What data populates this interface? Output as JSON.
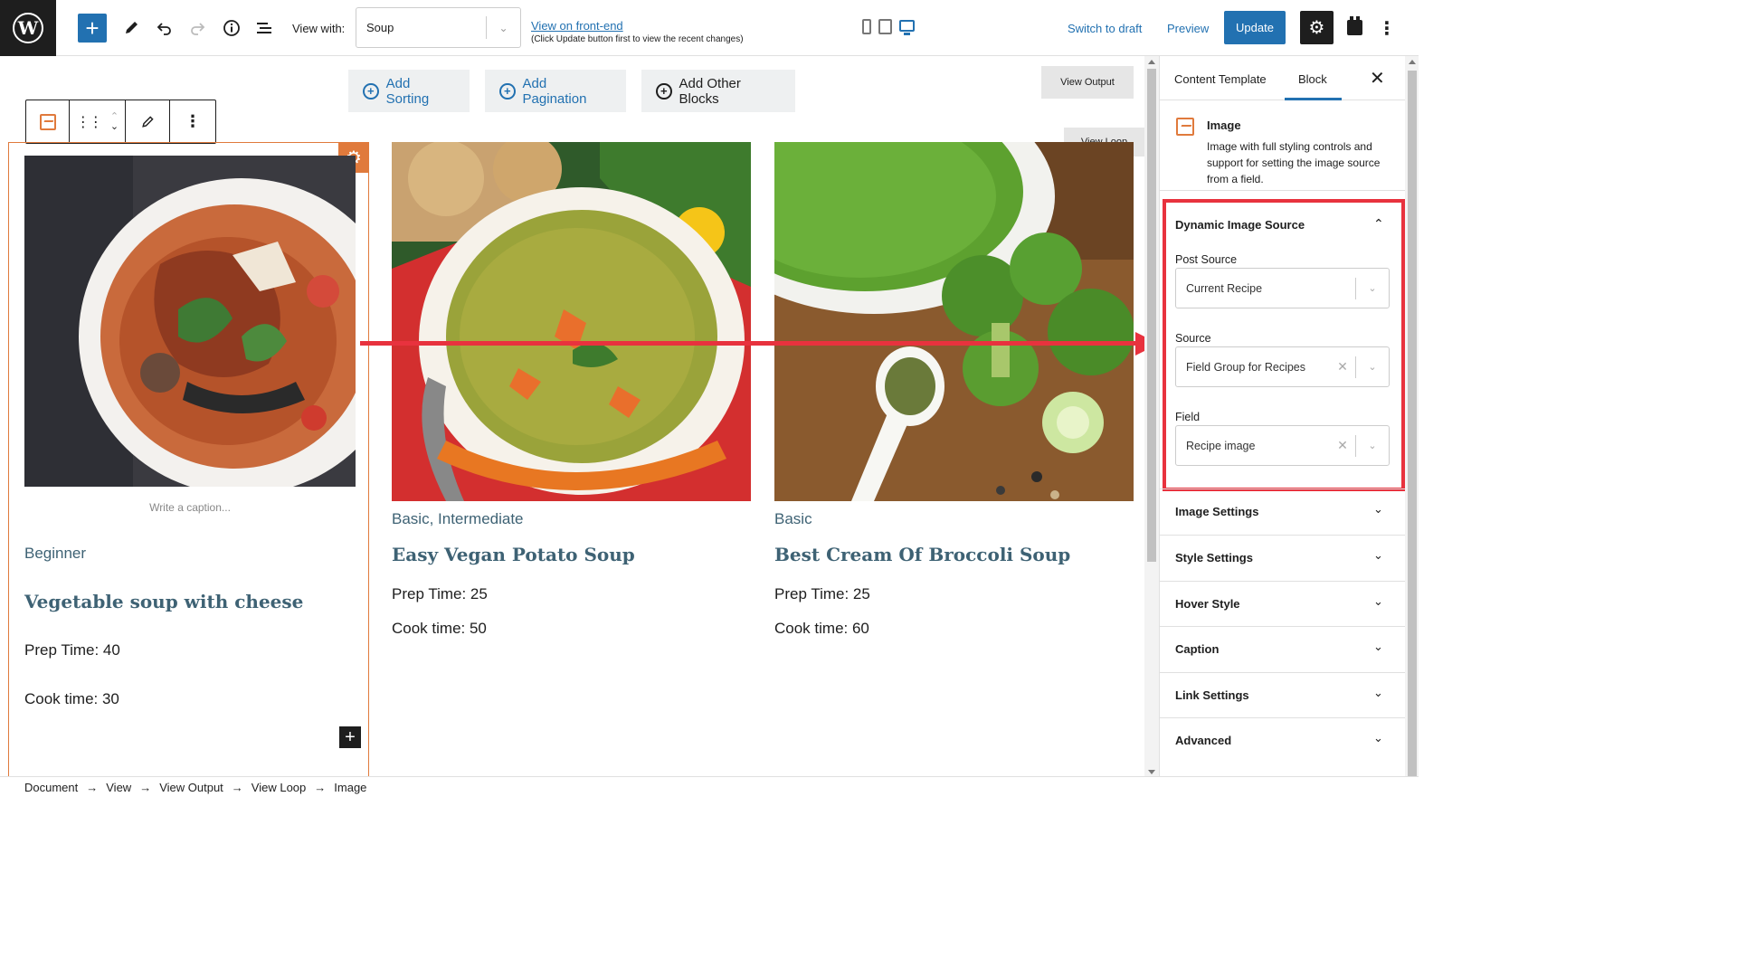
{
  "topbar": {
    "view_with_label": "View with:",
    "view_with_value": "Soup",
    "frontend_link": "View on front-end",
    "frontend_note": "(Click Update button first to view the recent changes)",
    "switch_to_draft": "Switch to draft",
    "preview": "Preview",
    "update": "Update",
    "icons": [
      "wordpress-logo",
      "plus-icon",
      "pencil-icon",
      "undo-icon",
      "redo-icon",
      "info-icon",
      "list-view-icon",
      "mobile-icon",
      "tablet-icon",
      "desktop-icon",
      "gear-icon",
      "plugin-icon",
      "more-icon"
    ]
  },
  "canvas": {
    "buttons": {
      "add_sorting": "Add Sorting",
      "add_pagination": "Add Pagination",
      "add_other_blocks": "Add Other Blocks",
      "view_output": "View Output",
      "view_loop": "View Loop"
    },
    "caption_placeholder": "Write a caption...",
    "cards": [
      {
        "level": "Beginner",
        "title": "Vegetable soup with cheese",
        "prep": "Prep Time: 40",
        "cook": "Cook time: 30",
        "image": "red curry soup with vegetables"
      },
      {
        "level": "Basic, Intermediate",
        "title": "Easy Vegan Potato Soup",
        "prep": "Prep Time: 25",
        "cook": "Cook time: 50",
        "image": "yellow vegetable soup with carrots"
      },
      {
        "level": "Basic",
        "title": "Best Cream Of Broccoli Soup",
        "prep": "Prep Time: 25",
        "cook": "Cook time: 60",
        "image": "green broccoli cream soup"
      }
    ]
  },
  "sidebar": {
    "tabs": [
      "Content Template",
      "Block"
    ],
    "active_tab": "Block",
    "block_name": "Image",
    "block_description": "Image with full styling controls and support for setting the image source from a field.",
    "panel_title": "Dynamic Image Source",
    "fields": [
      {
        "label": "Post Source",
        "value": "Current Recipe",
        "clearable": false
      },
      {
        "label": "Source",
        "value": "Field Group for Recipes",
        "clearable": true
      },
      {
        "label": "Field",
        "value": "Recipe image",
        "clearable": true
      }
    ],
    "sections": [
      "Image Settings",
      "Style Settings",
      "Hover Style",
      "Caption",
      "Link Settings",
      "Advanced"
    ]
  },
  "breadcrumb": [
    "Document",
    "View",
    "View Output",
    "View Loop",
    "Image"
  ],
  "colors": {
    "accent": "#2271b1",
    "selection": "#e07a3c",
    "highlight": "#e8323e",
    "title_text": "#3e6274"
  }
}
